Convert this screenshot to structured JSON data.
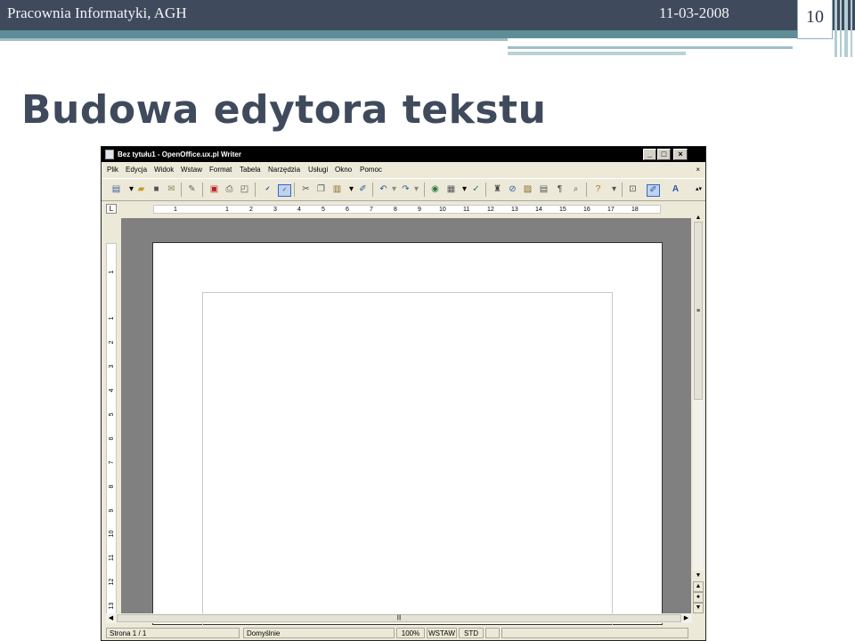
{
  "slide": {
    "header_left": "Pracownia Informatyki, AGH",
    "date": "11-03-2008",
    "page_number": "10",
    "title": "Budowa edytora tekstu",
    "colors": {
      "header_bg": "#3f4a5c",
      "accent": "#5e8d97",
      "title": "#3f4a5c"
    }
  },
  "window": {
    "title": "Bez tytułu1 - OpenOffice.ux.pl Writer",
    "menu": [
      "Plik",
      "Edycja",
      "Widok",
      "Wstaw",
      "Format",
      "Tabela",
      "Narzędzia",
      "Usługi",
      "Okno",
      "Pomoc"
    ],
    "menu_close": "×",
    "controls": {
      "minimize": "_",
      "maximize": "□",
      "close": "×"
    },
    "toolbar_icons": [
      "new-document",
      "open",
      "save",
      "email",
      "edit-file",
      "export-pdf",
      "print",
      "print-preview",
      "spellcheck",
      "autospellcheck",
      "cut",
      "copy",
      "paste",
      "format-paintbrush",
      "undo",
      "redo",
      "hyperlink",
      "table",
      "show-draw",
      "find-replace",
      "navigator",
      "gallery",
      "datasource",
      "nonprinting-chars",
      "zoom",
      "help",
      "styles",
      "fontwork"
    ],
    "ruler_corner": "L",
    "ruler_h_ticks": [
      "1",
      "1",
      "2",
      "3",
      "4",
      "5",
      "6",
      "7",
      "8",
      "9",
      "10",
      "11",
      "12",
      "13",
      "14",
      "15",
      "16",
      "17",
      "18"
    ],
    "ruler_v_ticks": [
      "1",
      "1",
      "2",
      "3",
      "4",
      "5",
      "6",
      "7",
      "8",
      "9",
      "10",
      "11",
      "12",
      "13"
    ],
    "statusbar": {
      "page": "Strona  1  / 1",
      "style": "Domyślnie",
      "zoom": "100%",
      "insert_mode": "WSTAW",
      "selection_mode": "STD"
    }
  }
}
